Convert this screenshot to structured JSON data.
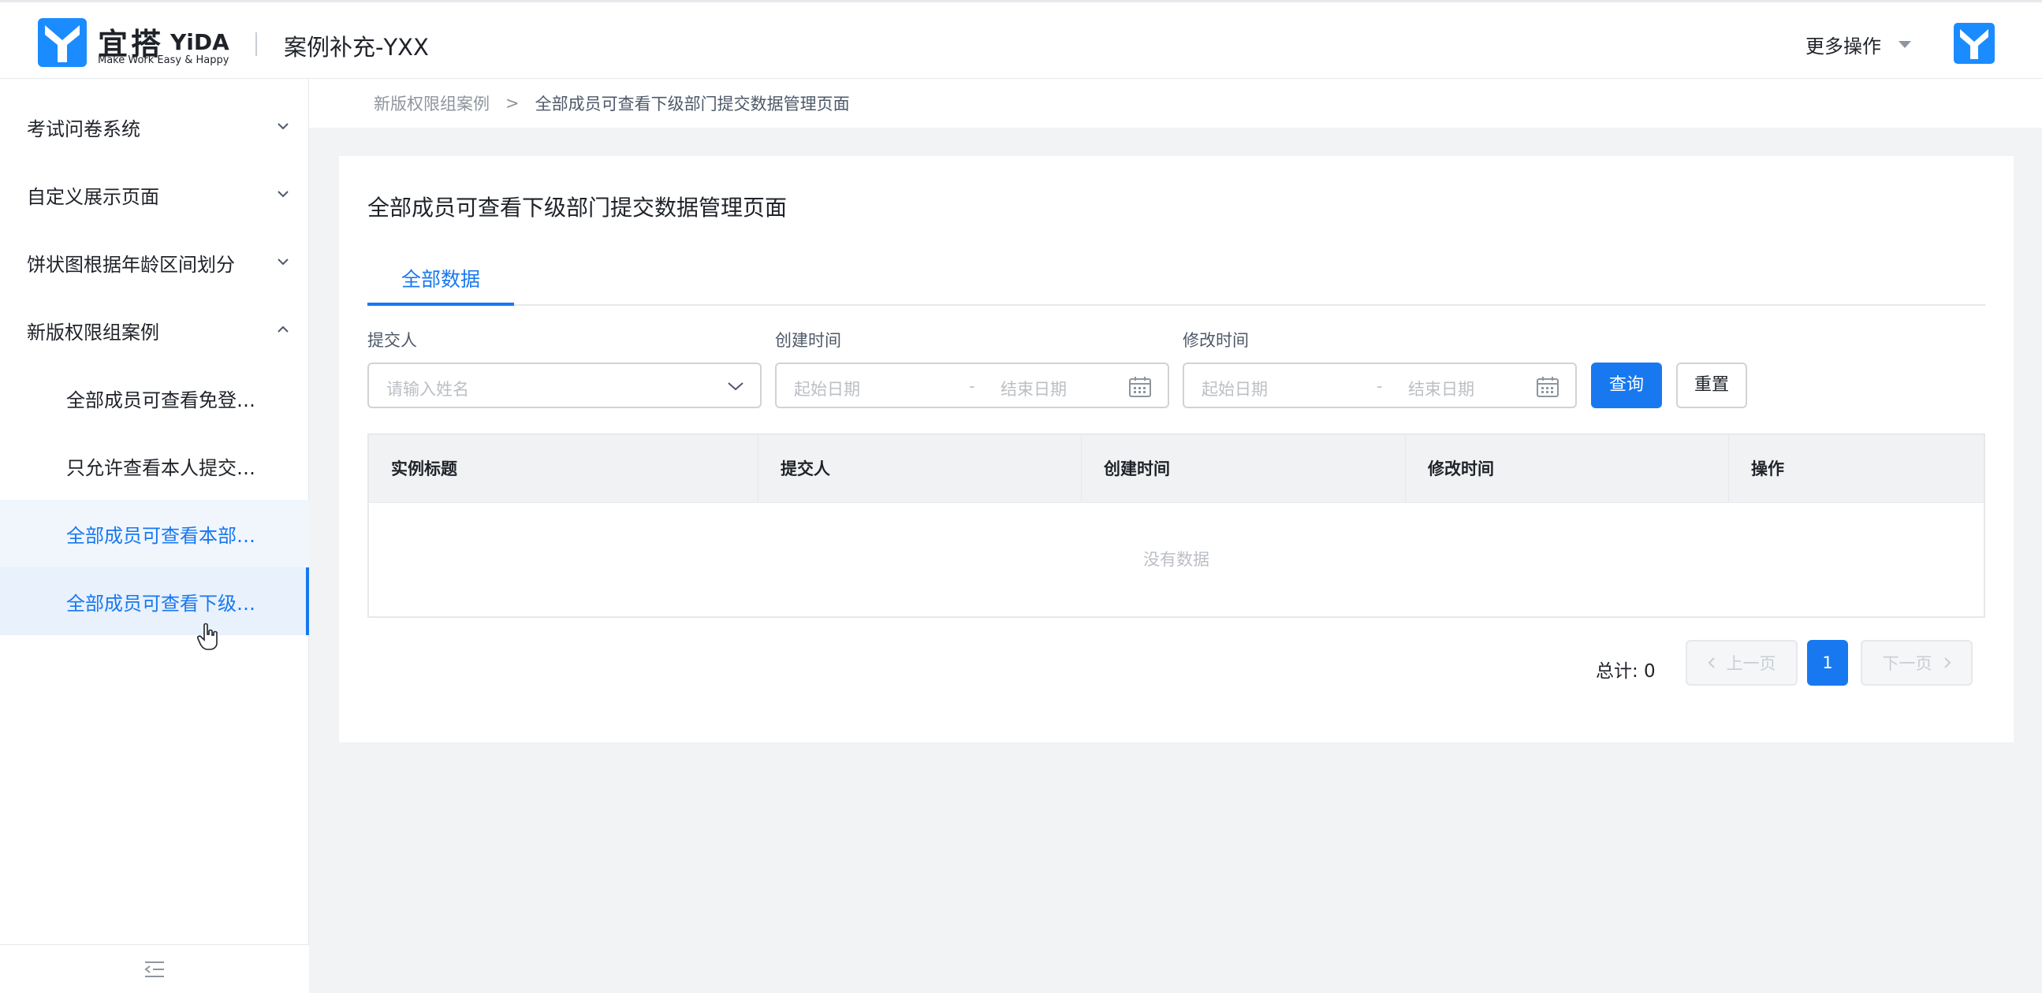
{
  "header": {
    "logo_cn": "宜搭",
    "logo_en": "YiDA",
    "logo_slogan": "Make Work Easy & Happy",
    "app_title": "案例补充-YXX",
    "more_actions": "更多操作"
  },
  "sidebar": {
    "groups": [
      {
        "label": "考试问卷系统",
        "expanded": false
      },
      {
        "label": "自定义展示页面",
        "expanded": false
      },
      {
        "label": "饼状图根据年龄区间划分",
        "expanded": false
      },
      {
        "label": "新版权限组案例",
        "expanded": true
      }
    ],
    "subitems": [
      {
        "label": "全部成员可查看免登…",
        "state": "normal"
      },
      {
        "label": "只允许查看本人提交…",
        "state": "normal"
      },
      {
        "label": "全部成员可查看本部…",
        "state": "hover"
      },
      {
        "label": "全部成员可查看下级…",
        "state": "active"
      }
    ]
  },
  "breadcrumb": {
    "parent": "新版权限组案例",
    "separator": ">",
    "current": "全部成员可查看下级部门提交数据管理页面"
  },
  "page": {
    "title": "全部成员可查看下级部门提交数据管理页面",
    "tab": "全部数据"
  },
  "filters": {
    "submitter_label": "提交人",
    "submitter_placeholder": "请输入姓名",
    "created_label": "创建时间",
    "modified_label": "修改时间",
    "start_placeholder": "起始日期",
    "end_placeholder": "结束日期",
    "range_dash": "-",
    "search_button": "查询",
    "reset_button": "重置"
  },
  "table": {
    "columns": [
      "实例标题",
      "提交人",
      "创建时间",
      "修改时间",
      "操作"
    ],
    "empty_text": "没有数据"
  },
  "pagination": {
    "total_label": "总计: 0",
    "prev": "上一页",
    "current_page": "1",
    "next": "下一页"
  },
  "colors": {
    "primary": "#1878f0",
    "background": "#f1f3f5"
  }
}
